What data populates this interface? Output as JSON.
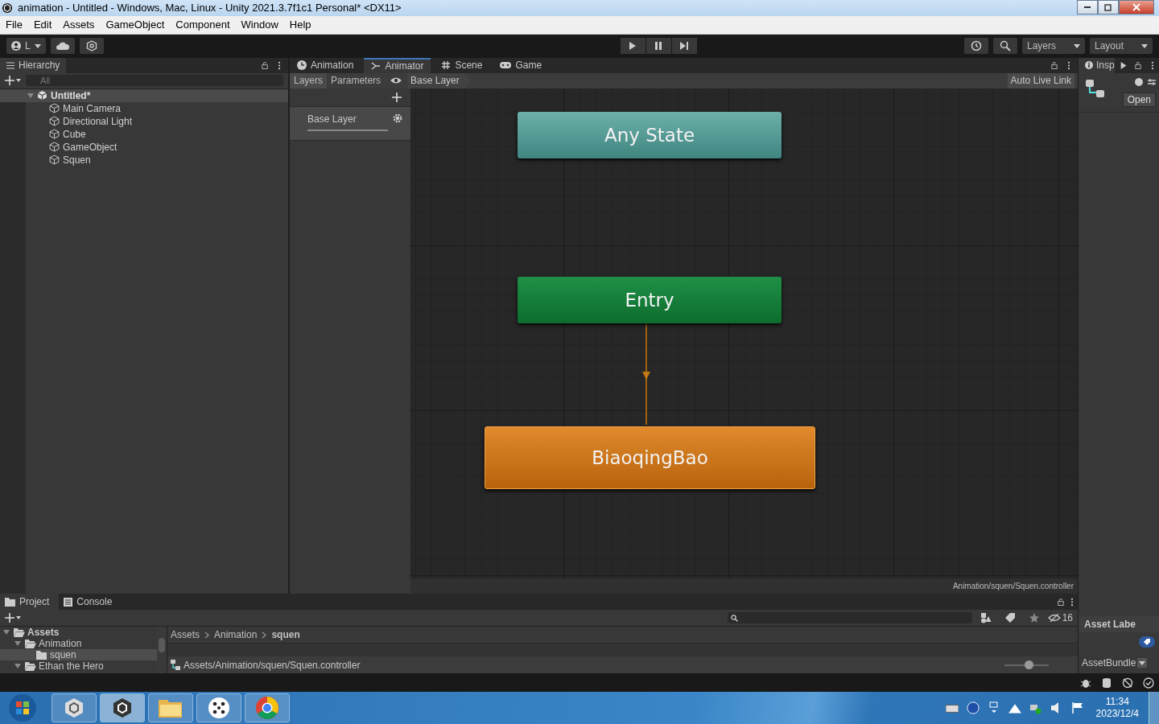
{
  "window": {
    "title": "animation - Untitled - Windows, Mac, Linux - Unity 2021.3.7f1c1 Personal* <DX11>"
  },
  "menu": [
    "File",
    "Edit",
    "Assets",
    "GameObject",
    "Component",
    "Window",
    "Help"
  ],
  "toolbar": {
    "account": "L",
    "search_layers": "Layers",
    "layout": "Layout"
  },
  "hierarchy": {
    "tab": "Hierarchy",
    "placeholder": "All",
    "scene": {
      "name": "Untitled*",
      "expanded": true,
      "children": [
        {
          "name": "Main Camera"
        },
        {
          "name": "Directional Light"
        },
        {
          "name": "Cube"
        },
        {
          "name": "GameObject"
        },
        {
          "name": "Squen"
        }
      ]
    }
  },
  "editor_tabs": [
    {
      "label": "Animation",
      "kind": "clock",
      "selected": false
    },
    {
      "label": "Animator",
      "kind": "graph",
      "selected": true
    },
    {
      "label": "Scene",
      "kind": "grid",
      "selected": false
    },
    {
      "label": "Game",
      "kind": "gamepad",
      "selected": false
    }
  ],
  "animator": {
    "subtabs": [
      {
        "label": "Layers",
        "selected": true
      },
      {
        "label": "Parameters",
        "selected": false
      }
    ],
    "breadcrumb": "Base Layer",
    "auto_live_link": "Auto Live Link",
    "layers": [
      {
        "name": "Base Layer"
      }
    ],
    "nodes": [
      {
        "label": "Any State",
        "kind": "any_state"
      },
      {
        "label": "Entry",
        "kind": "entry"
      },
      {
        "label": "BiaoqingBao",
        "kind": "state"
      }
    ],
    "path": "Animation/squen/Squen.controller"
  },
  "inspector": {
    "tab": "Insp",
    "open_button": "Open",
    "asset_labels": "Asset Labe",
    "asset_bundle": "AssetBundle"
  },
  "project": {
    "tabs": [
      {
        "label": "Project",
        "selected": true
      },
      {
        "label": "Console",
        "selected": false
      }
    ],
    "tree": [
      {
        "name": "Assets",
        "expanded": true,
        "selected": false,
        "children": [
          {
            "name": "Animation",
            "expanded": true,
            "selected": false,
            "children": [
              {
                "name": "squen",
                "selected": true
              }
            ]
          },
          {
            "name": "Ethan the Hero",
            "expanded": true,
            "selected": false
          }
        ]
      }
    ],
    "breadcrumb": [
      "Assets",
      "Animation",
      "squen"
    ],
    "hidden_count": "16",
    "selected_path": "Assets/Animation/squen/Squen.controller",
    "icon_size": {
      "level": 0.55
    }
  },
  "taskbar": {
    "apps": [
      {
        "kind": "unity",
        "selected": false
      },
      {
        "kind": "unity",
        "selected": true
      },
      {
        "kind": "folder",
        "selected": false
      },
      {
        "kind": "dots",
        "selected": false
      },
      {
        "kind": "chrome",
        "selected": false
      }
    ],
    "time": "11:34",
    "date": "2023/12/4"
  }
}
